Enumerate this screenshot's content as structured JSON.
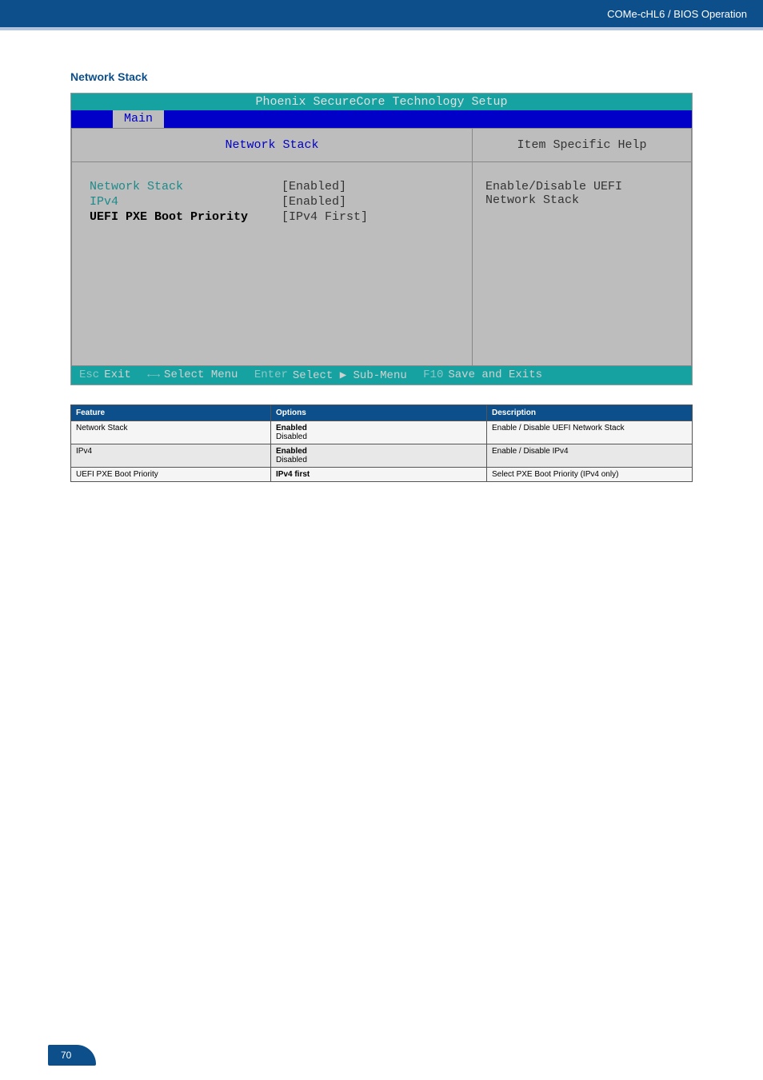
{
  "header": {
    "breadcrumb": "COMe-cHL6 / BIOS Operation"
  },
  "section_title": "Network Stack",
  "bios": {
    "title": "Phoenix SecureCore Technology Setup",
    "tab": "Main",
    "left_title": "Network Stack",
    "right_title": "Item Specific Help",
    "rows": [
      {
        "label": "Network Stack",
        "value": "[Enabled]",
        "style": "teal"
      },
      {
        "label": "IPv4",
        "value": "[Enabled]",
        "style": "teal"
      },
      {
        "label": "UEFI PXE Boot Priority",
        "value": "[IPv4 First]",
        "style": "bold"
      }
    ],
    "help_lines": [
      "Enable/Disable UEFI",
      "Network Stack"
    ],
    "footer": {
      "esc": "Esc",
      "exit": "Exit",
      "arrows": "←→",
      "select_menu": "Select Menu",
      "enter": "Enter",
      "select_sub": "Select ▶ Sub-Menu",
      "f10": "F10",
      "save": "Save and Exits"
    }
  },
  "table": {
    "headers": [
      "Feature",
      "Options",
      "Description"
    ],
    "rows": [
      {
        "feature": "Network Stack",
        "opt_bold": "Enabled",
        "opt_rest": "Disabled",
        "desc": "Enable / Disable UEFI Network Stack"
      },
      {
        "feature": "IPv4",
        "opt_bold": "Enabled",
        "opt_rest": "Disabled",
        "desc": "Enable / Disable IPv4"
      },
      {
        "feature": "UEFI PXE Boot Priority",
        "opt_bold": "IPv4 first",
        "opt_rest": "",
        "desc": "Select PXE Boot Priority (IPv4 only)"
      }
    ]
  },
  "page_number": "70"
}
